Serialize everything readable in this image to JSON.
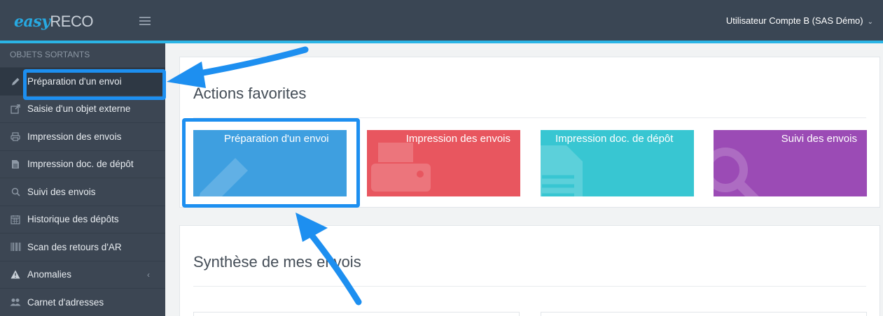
{
  "header": {
    "logo_prefix": "easy",
    "logo_suffix": "RECO",
    "user_label": "Utilisateur Compte B (SAS Démo)",
    "user_caret": "⌄"
  },
  "sidebar": {
    "section_title": "OBJETS SORTANTS",
    "items": [
      {
        "label": "Préparation d'un envoi",
        "icon": "pencil-icon",
        "active": true
      },
      {
        "label": "Saisie d'un objet externe",
        "icon": "external-link-icon"
      },
      {
        "label": "Impression des envois",
        "icon": "printer-icon"
      },
      {
        "label": "Impression doc. de dépôt",
        "icon": "document-icon"
      },
      {
        "label": "Suivi des envois",
        "icon": "search-icon"
      },
      {
        "label": "Historique des dépôts",
        "icon": "calendar-icon"
      },
      {
        "label": "Scan des retours d'AR",
        "icon": "barcode-icon"
      },
      {
        "label": "Anomalies",
        "icon": "warning-icon",
        "chevron": "‹"
      },
      {
        "label": "Carnet d'adresses",
        "icon": "users-icon"
      }
    ]
  },
  "favorites": {
    "title": "Actions favorites",
    "tiles": [
      {
        "label": "Préparation d'un envoi",
        "color": "#3e9fe0"
      },
      {
        "label": "Impression des envois",
        "color": "#e8565f"
      },
      {
        "label": "Impression doc. de dépôt",
        "color": "#38c6d2"
      },
      {
        "label": "Suivi des envois",
        "color": "#9b4bb5"
      }
    ]
  },
  "summary": {
    "title": "Synthèse de mes envois"
  },
  "colors": {
    "topbar": "#3a4654",
    "accent": "#2bb5e6",
    "sidebar": "#3c4653",
    "annotation": "#1d8ff0"
  }
}
